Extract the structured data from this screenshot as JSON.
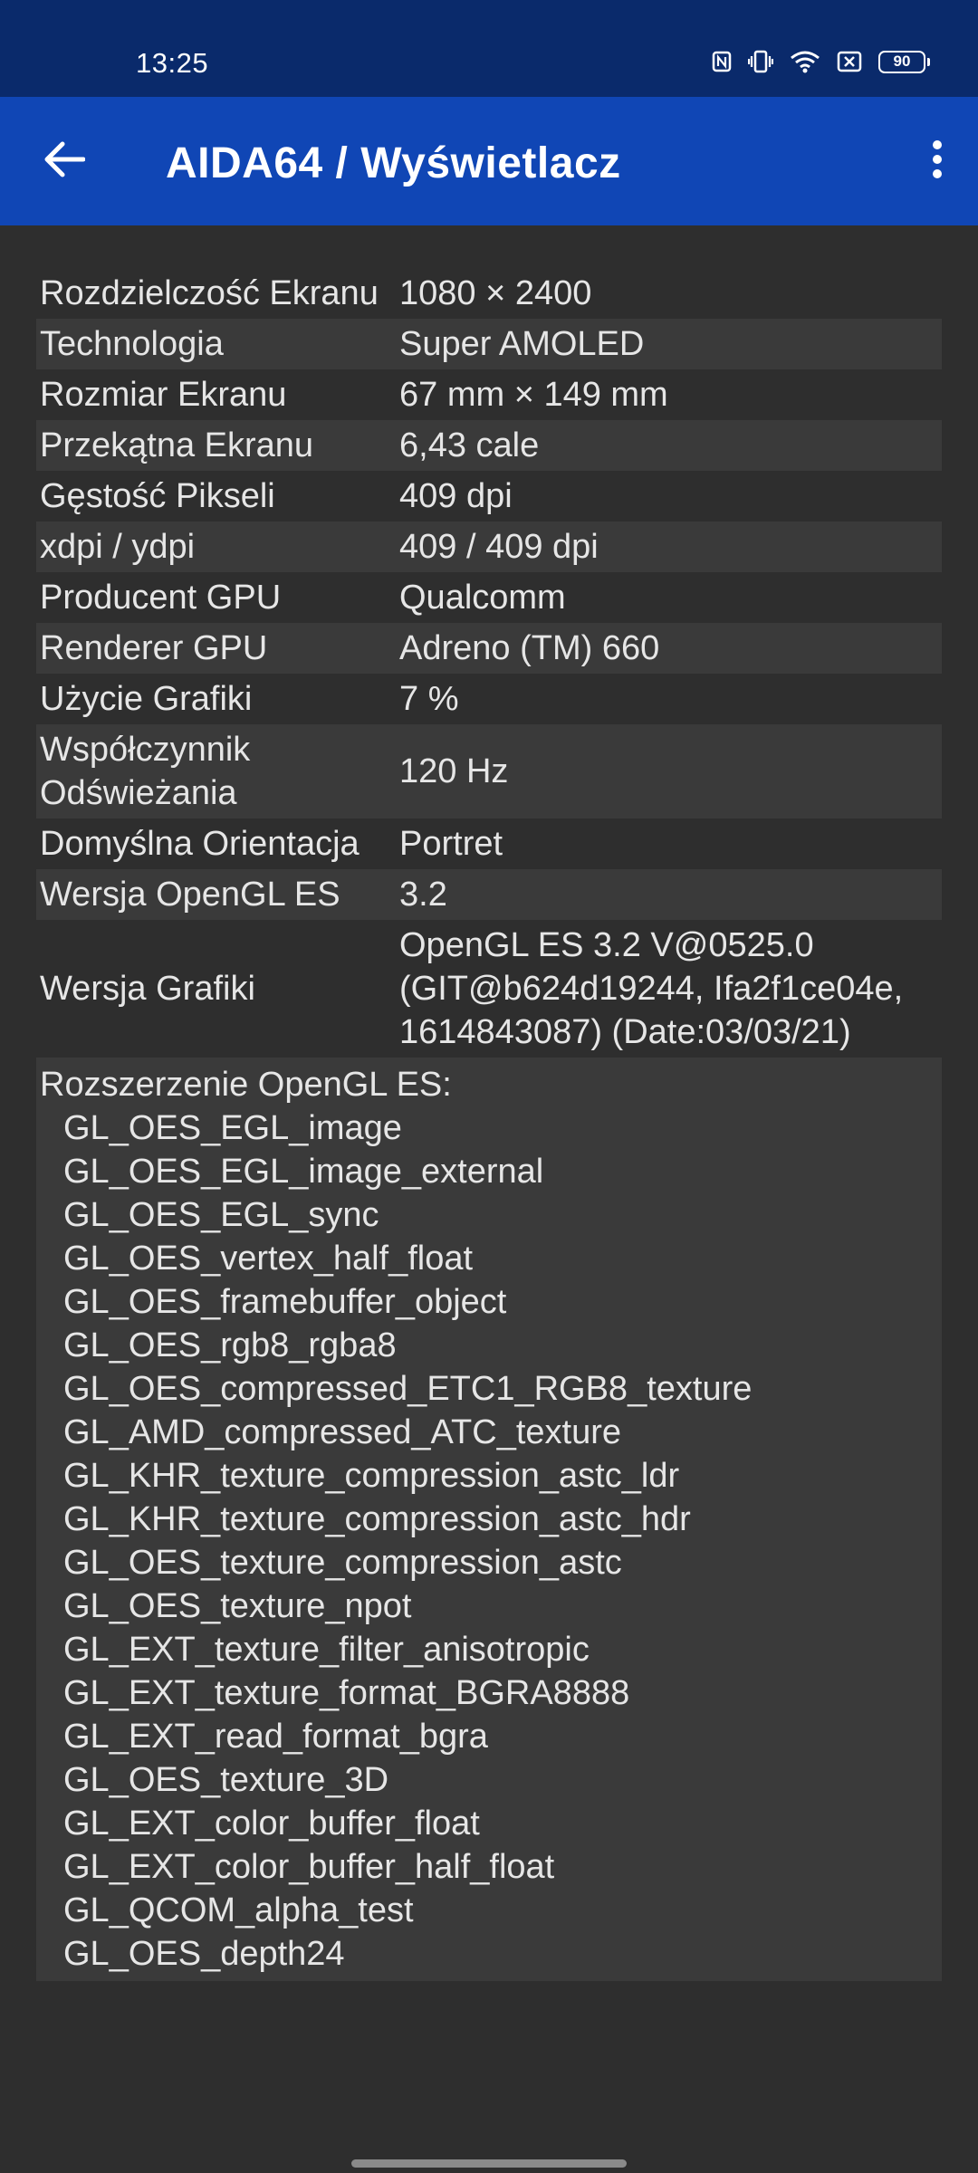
{
  "status_bar": {
    "time": "13:25",
    "battery": "90",
    "icons": [
      "nfc-icon",
      "vibrate-icon",
      "wifi-icon",
      "sim-off-icon"
    ]
  },
  "app_bar": {
    "title": "AIDA64  /  Wyświetlacz",
    "back_icon": "arrow-left-icon",
    "menu_icon": "more-vert-icon"
  },
  "rows": [
    {
      "label": "Rozdzielczość Ekranu",
      "value": "1080 × 2400"
    },
    {
      "label": "Technologia",
      "value": "Super AMOLED"
    },
    {
      "label": "Rozmiar Ekranu",
      "value": "67 mm × 149 mm"
    },
    {
      "label": "Przekątna Ekranu",
      "value": "6,43 cale"
    },
    {
      "label": "Gęstość Pikseli",
      "value": "409 dpi"
    },
    {
      "label": "xdpi / ydpi",
      "value": "409 / 409 dpi"
    },
    {
      "label": "Producent GPU",
      "value": "Qualcomm"
    },
    {
      "label": "Renderer GPU",
      "value": "Adreno (TM) 660"
    },
    {
      "label": "Użycie Grafiki",
      "value": "7 %"
    },
    {
      "label": "Współczynnik Odświeżania",
      "value": "120 Hz"
    },
    {
      "label": "Domyślna Orientacja",
      "value": "Portret"
    },
    {
      "label": "Wersja OpenGL ES",
      "value": "3.2"
    },
    {
      "label": "Wersja Grafiki",
      "value": "OpenGL ES 3.2 V@0525.0 (GIT@b624d19244, Ifa2f1ce04e, 1614843087) (Date:03/03/21)"
    }
  ],
  "extensions": {
    "header": "Rozszerzenie OpenGL ES:",
    "items": [
      "GL_OES_EGL_image",
      "GL_OES_EGL_image_external",
      "GL_OES_EGL_sync",
      "GL_OES_vertex_half_float",
      "GL_OES_framebuffer_object",
      "GL_OES_rgb8_rgba8",
      "GL_OES_compressed_ETC1_RGB8_texture",
      "GL_AMD_compressed_ATC_texture",
      "GL_KHR_texture_compression_astc_ldr",
      "GL_KHR_texture_compression_astc_hdr",
      "GL_OES_texture_compression_astc",
      "GL_OES_texture_npot",
      "GL_EXT_texture_filter_anisotropic",
      "GL_EXT_texture_format_BGRA8888",
      "GL_EXT_read_format_bgra",
      "GL_OES_texture_3D",
      "GL_EXT_color_buffer_float",
      "GL_EXT_color_buffer_half_float",
      "GL_QCOM_alpha_test",
      "GL_OES_depth24"
    ]
  },
  "colors": {
    "status_bar": "#0a2a6b",
    "app_bar": "#1046b5",
    "background": "#2e2e2e",
    "row_alt": "#3a3a3a",
    "text": "#e6e6e6"
  }
}
